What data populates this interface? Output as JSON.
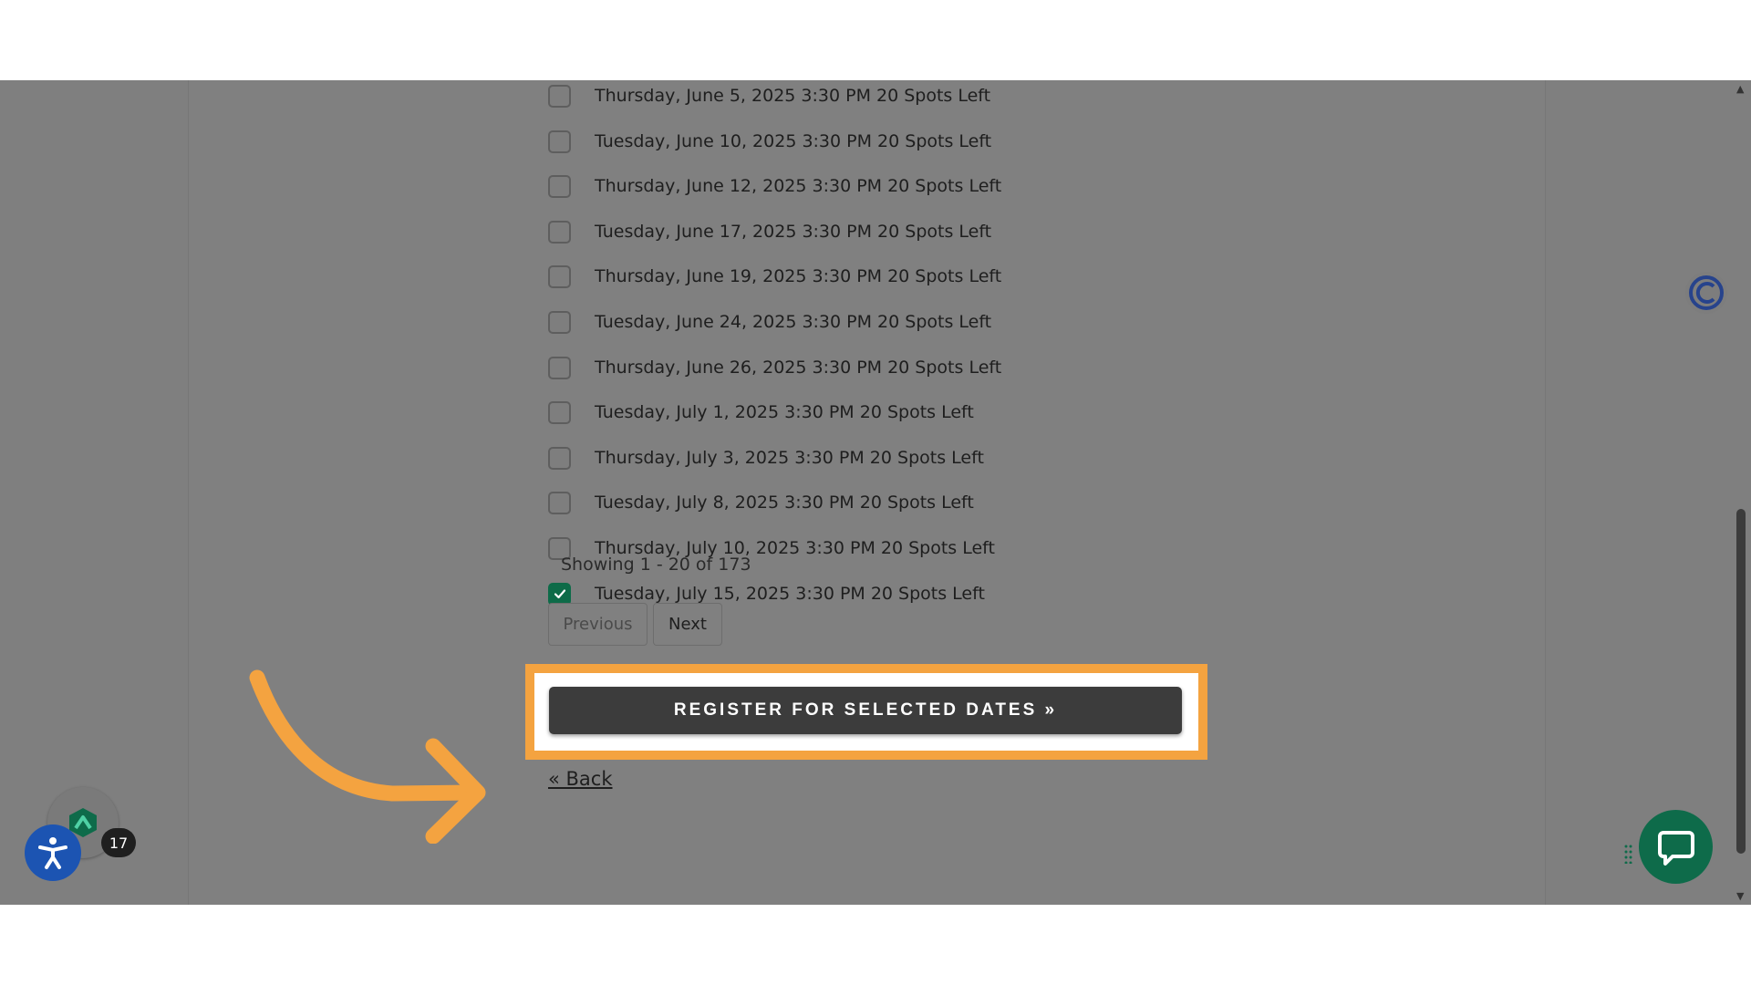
{
  "dates": [
    {
      "label": "Thursday, June 5, 2025 3:30 PM 20 Spots Left",
      "checked": false
    },
    {
      "label": "Tuesday, June 10, 2025 3:30 PM 20 Spots Left",
      "checked": false
    },
    {
      "label": "Thursday, June 12, 2025 3:30 PM 20 Spots Left",
      "checked": false
    },
    {
      "label": "Tuesday, June 17, 2025 3:30 PM 20 Spots Left",
      "checked": false
    },
    {
      "label": "Thursday, June 19, 2025 3:30 PM 20 Spots Left",
      "checked": false
    },
    {
      "label": "Tuesday, June 24, 2025 3:30 PM 20 Spots Left",
      "checked": false
    },
    {
      "label": "Thursday, June 26, 2025 3:30 PM 20 Spots Left",
      "checked": false
    },
    {
      "label": "Tuesday, July 1, 2025 3:30 PM 20 Spots Left",
      "checked": false
    },
    {
      "label": "Thursday, July 3, 2025 3:30 PM 20 Spots Left",
      "checked": false
    },
    {
      "label": "Tuesday, July 8, 2025 3:30 PM 20 Spots Left",
      "checked": false
    },
    {
      "label": "Thursday, July 10, 2025 3:30 PM 20 Spots Left",
      "checked": false
    },
    {
      "label": "Tuesday, July 15, 2025 3:30 PM 20 Spots Left",
      "checked": true
    }
  ],
  "pagination": {
    "showing": "Showing 1 - 20 of 173",
    "previous_label": "Previous",
    "next_label": "Next"
  },
  "register_label": "REGISTER FOR SELECTED DATES »",
  "back_label": "« Back",
  "badge_count": "17",
  "colors": {
    "overlay": "#7f7f7f",
    "highlight": "#f4a340",
    "checked": "#0d6b48",
    "chat": "#0e6b4a",
    "accessibility": "#1c54b2"
  },
  "icons": {
    "checkmark": "check-icon",
    "accessibility": "accessibility-icon",
    "app": "app-logo-icon",
    "chat": "chat-bubble-icon",
    "side_logo": "side-logo-icon",
    "annotation": "arrow-annotation"
  }
}
